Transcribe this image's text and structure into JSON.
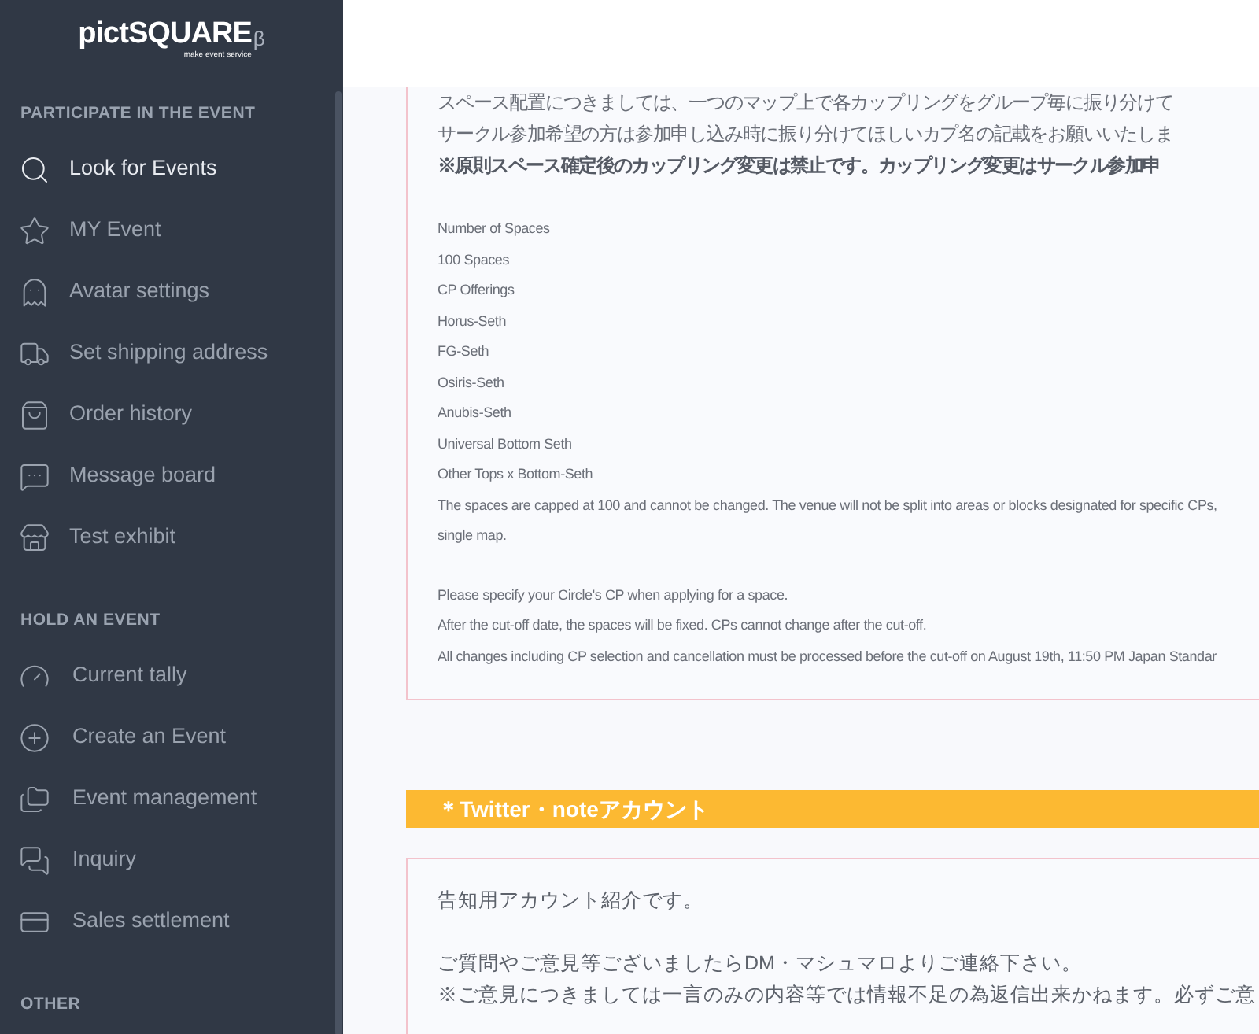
{
  "sidebar": {
    "logo": {
      "name": "pictSQUARE",
      "badge": "β",
      "tagline": "make event service"
    },
    "sections": [
      {
        "title": "PARTICIPATE IN THE EVENT",
        "items": [
          {
            "label": "Look for Events",
            "selected": true
          },
          {
            "label": "MY Event",
            "selected": false
          },
          {
            "label": "Avatar settings",
            "selected": false
          },
          {
            "label": "Set shipping address",
            "selected": false
          },
          {
            "label": "Order history",
            "selected": false
          },
          {
            "label": "Message board",
            "selected": false
          },
          {
            "label": "Test exhibit",
            "selected": false
          }
        ]
      },
      {
        "title": "HOLD AN EVENT",
        "items": [
          {
            "label": "Current tally",
            "selected": false
          },
          {
            "label": "Create an Event",
            "selected": false
          },
          {
            "label": "Event management",
            "selected": false
          },
          {
            "label": "Inquiry",
            "selected": false
          },
          {
            "label": "Sales settlement",
            "selected": false
          }
        ]
      },
      {
        "title": "OTHER"
      }
    ]
  },
  "content": {
    "notice_box": {
      "intro": [
        "スペース配置につきましては、一つのマップ上で各カップリングをグループ毎に振り分けて",
        "サークル参加希望の方は参加申し込み時に振り分けてほしいカプ名の記載をお願いいたしま"
      ],
      "warning": "※原則スペース確定後のカップリング変更は禁止です。カップリング変更はサークル参加申",
      "lines": [
        "Number of Spaces",
        "100 Spaces",
        "CP Offerings",
        "Horus-Seth",
        "FG-Seth",
        "Osiris-Seth",
        "Anubis-Seth",
        "Universal Bottom Seth",
        "Other Tops x Bottom-Seth",
        "The spaces are capped at 100 and cannot be changed. The venue will not be split into areas or blocks designated for specific CPs,",
        "single map."
      ],
      "lines_after": [
        "Please specify your Circle's CP when applying for a space.",
        "After the cut-off date, the spaces will be fixed. CPs cannot change after the cut-off.",
        "All changes including CP selection and cancellation must be processed before the cut-off on August 19th, 11:50 PM Japan Standar"
      ]
    },
    "section_heading": "＊Twitter・noteアカウント",
    "account_box": {
      "paragraphs": [
        [
          "告知用アカウント紹介です。"
        ],
        [
          "ご質問やご意見等ございましたらDM・マシュマロよりご連絡下さい。",
          "※ご意見につきましては一言のみの内容等では情報不足の為返信出来かねます。必ずご意"
        ]
      ]
    }
  }
}
